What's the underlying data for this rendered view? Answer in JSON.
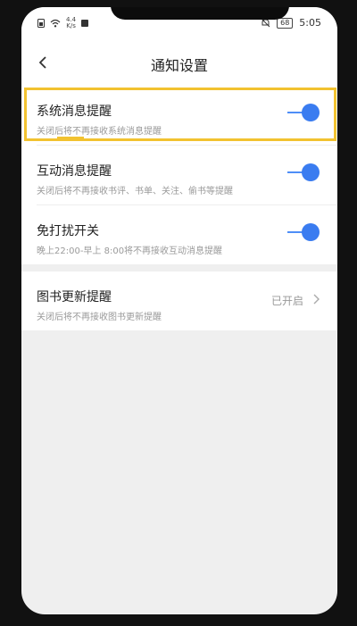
{
  "status_bar": {
    "net_speed_top": "4.4",
    "net_speed_bottom": "K/s",
    "battery": "68",
    "time": "5:05"
  },
  "header": {
    "title": "通知设置"
  },
  "settings": [
    {
      "title": "系统消息提醒",
      "desc": "关闭后将不再接收系统消息提醒",
      "enabled": true
    },
    {
      "title": "互动消息提醒",
      "desc": "关闭后将不再接收书评、书单、关注、偷书等提醒",
      "enabled": true
    },
    {
      "title": "免打扰开关",
      "desc": "晚上22:00-早上 8:00将不再接收互动消息提醒",
      "enabled": true
    }
  ],
  "book_update": {
    "title": "图书更新提醒",
    "desc": "关闭后将不再接收图书更新提醒",
    "value": "已开启"
  },
  "colors": {
    "accent": "#3a7cf0",
    "highlight": "#f2c230"
  }
}
